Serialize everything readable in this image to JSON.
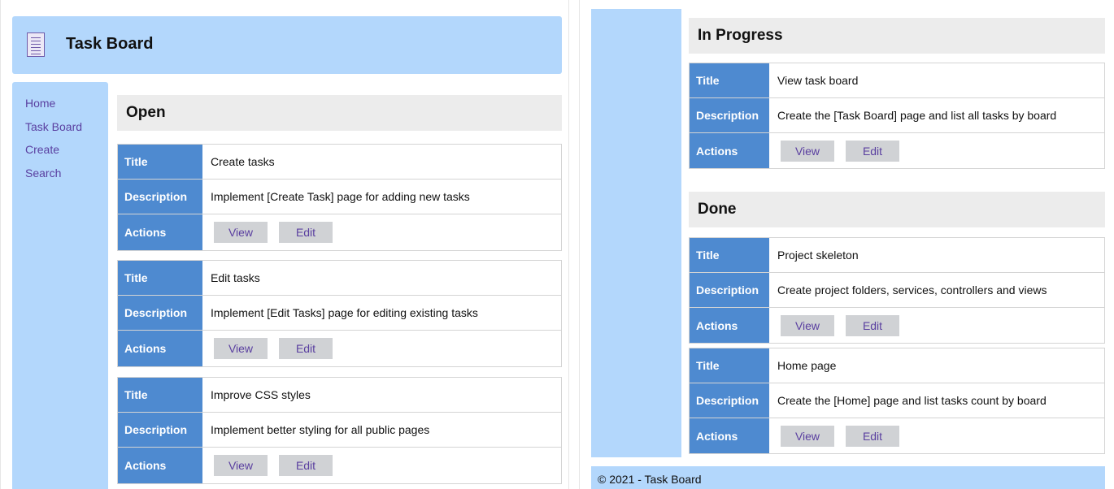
{
  "app": {
    "title": "Task Board"
  },
  "nav": {
    "items": [
      "Home",
      "Task Board",
      "Create",
      "Search"
    ]
  },
  "labels": {
    "title": "Title",
    "description": "Description",
    "actions": "Actions",
    "view": "View",
    "edit": "Edit"
  },
  "boards": {
    "open": {
      "name": "Open",
      "tasks": [
        {
          "title": "Create tasks",
          "description": "Implement [Create Task] page for adding new tasks"
        },
        {
          "title": "Edit tasks",
          "description": "Implement [Edit Tasks] page for editing existing tasks"
        },
        {
          "title": "Improve CSS styles",
          "description": "Implement better styling for all public pages"
        }
      ]
    },
    "in_progress": {
      "name": "In Progress",
      "tasks": [
        {
          "title": "View task board",
          "description": "Create the [Task Board] page and list all tasks by board"
        }
      ]
    },
    "done": {
      "name": "Done",
      "tasks": [
        {
          "title": "Project skeleton",
          "description": "Create project folders, services, controllers and views"
        },
        {
          "title": "Home page",
          "description": "Create the [Home] page and list tasks count by board"
        }
      ]
    }
  },
  "footer": {
    "text": "© 2021 - Task Board"
  },
  "colors": {
    "header_bg": "#b3d7fc",
    "label_bg": "#4e8ad0",
    "section_bg": "#ececec",
    "button_bg": "#d0d2d5",
    "link": "#5a3fa0"
  }
}
